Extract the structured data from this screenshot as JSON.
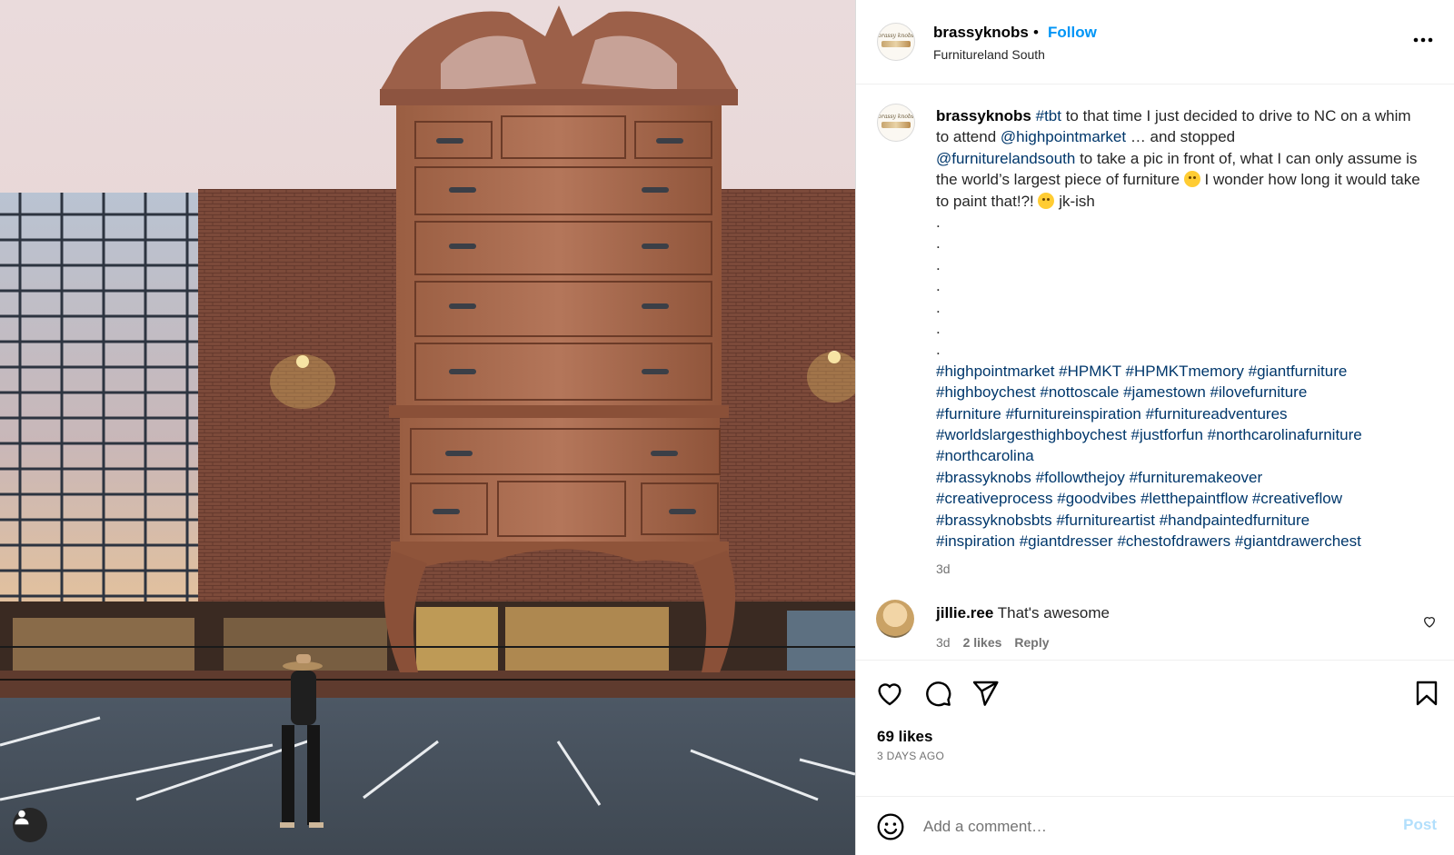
{
  "post": {
    "username": "brassyknobs",
    "separator": "•",
    "follow_label": "Follow",
    "location": "Furnitureland South"
  },
  "caption": {
    "username": "brassyknobs",
    "hashtag_tbt": "#tbt",
    "text1": " to that time I just decided to drive to NC on a whim to attend ",
    "mention1": "@highpointmarket",
    "text2": " … and stopped ",
    "mention2": "@furniturelandsouth",
    "text3": " to take a pic in front of, what I can only assume is the world’s largest piece of furniture ",
    "text4": " I wonder how long it would take to paint that!?! ",
    "text5": " jk-ish",
    "dots": [
      ".",
      ".",
      ".",
      ".",
      ".",
      ".",
      "."
    ],
    "hashtag_lines": [
      [
        "#highpointmarket",
        "#HPMKT",
        "#HPMKTmemory",
        "#giantfurniture"
      ],
      [
        "#highboychest",
        "#nottoscale",
        "#jamestown",
        "#ilovefurniture"
      ],
      [
        "#furniture",
        "#furnitureinspiration",
        "#furnitureadventures"
      ],
      [
        "#worldslargesthighboychest",
        "#justforfun",
        "#northcarolinafurniture"
      ],
      [
        "#northcarolina"
      ],
      [
        "#brassyknobs",
        "#followthejoy",
        "#furnituremakeover"
      ],
      [
        "#creativeprocess",
        "#goodvibes",
        "#letthepaintflow",
        "#creativeflow"
      ],
      [
        "#brassyknobsbts",
        "#furnitureartist",
        "#handpaintedfurniture"
      ],
      [
        "#inspiration",
        "#giantdresser",
        "#chestofdrawers",
        "#giantdrawerchest"
      ]
    ],
    "time": "3d"
  },
  "comment": {
    "username": "jillie.ree",
    "text": "That's awesome",
    "time": "3d",
    "likes": "2 likes",
    "reply_label": "Reply"
  },
  "engagement": {
    "likes": "69 likes",
    "posted": "3 DAYS AGO"
  },
  "add_comment": {
    "placeholder": "Add a comment…",
    "post_label": "Post"
  },
  "icons": {
    "more": "more-horizontal-icon",
    "like": "heart-icon",
    "comment": "comment-bubble-icon",
    "share": "paper-plane-icon",
    "save": "bookmark-icon",
    "emoji": "emoji-smiley-icon",
    "user_tag": "user-tag-icon"
  },
  "colors": {
    "link": "#00376b",
    "follow": "#0095f6",
    "post_disabled": "#b2dffc",
    "muted": "#737373"
  }
}
